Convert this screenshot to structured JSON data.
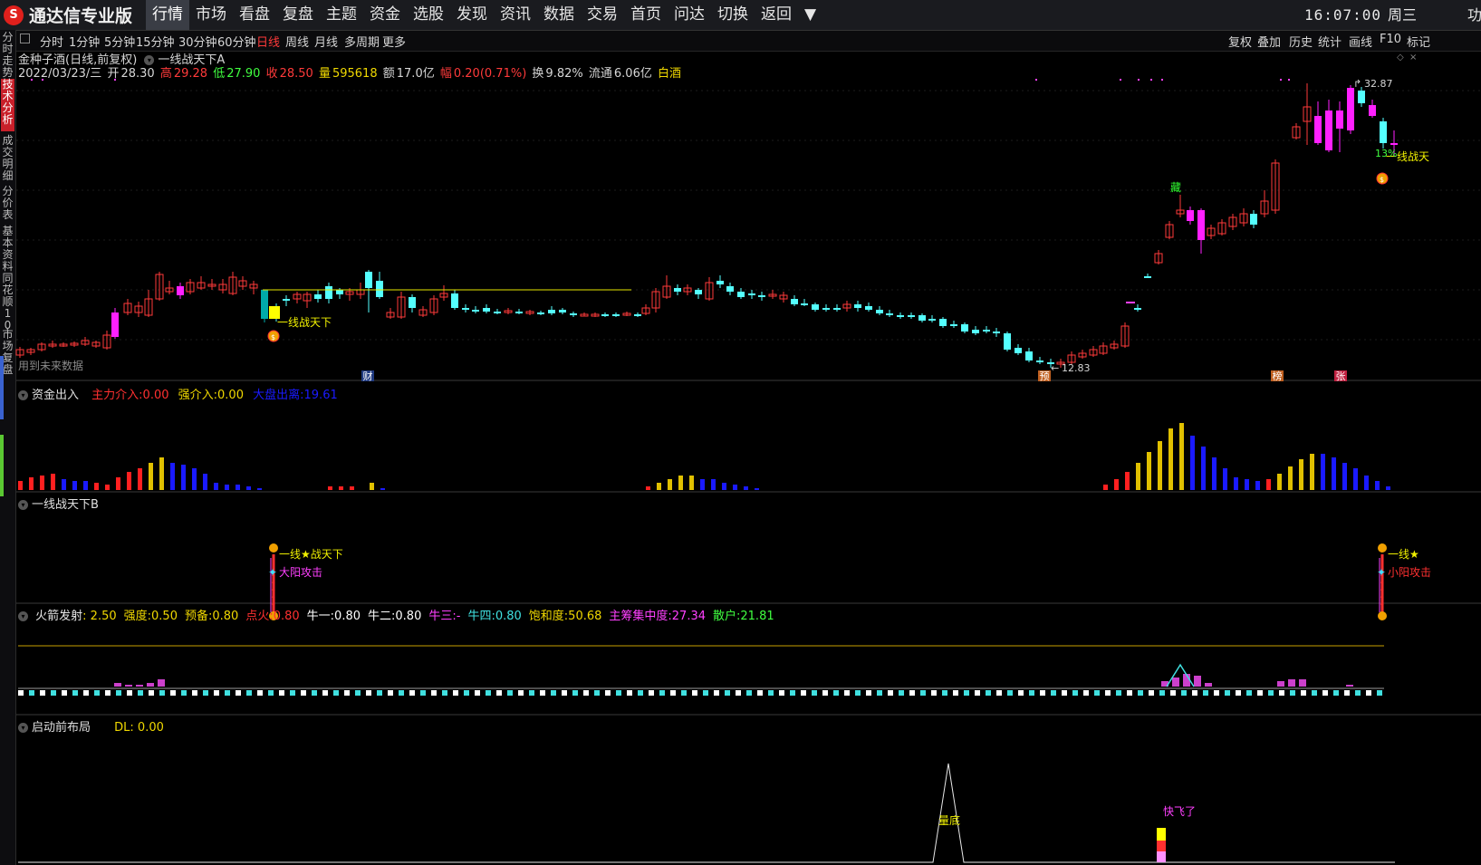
{
  "app": {
    "logo_glyph": "S",
    "title": "通达信专业版"
  },
  "menu": [
    "行情",
    "市场",
    "看盘",
    "复盘",
    "主题",
    "资金",
    "选股",
    "发现",
    "资讯",
    "数据",
    "交易",
    "首页",
    "问达",
    "切换",
    "返回",
    "▼"
  ],
  "clock": {
    "time": "16:07:00",
    "weekday": "周三",
    "right_char": "功"
  },
  "sidebar": [
    "分时走势",
    "技术分析",
    "成交明细",
    "分价表",
    "基本资料",
    "同花顺10",
    "市场复盘"
  ],
  "toolbar": {
    "left": [
      "分时",
      "1分钟",
      "5分钟",
      "15分钟",
      "30分钟",
      "60分钟",
      "日线",
      "周线",
      "月线",
      "多周期",
      "更多"
    ],
    "active": "日线",
    "right": [
      "复权",
      "叠加",
      "历史",
      "统计",
      "画线",
      "F10",
      "标记"
    ]
  },
  "stock": {
    "name_line": "金种子酒(日线,前复权)",
    "indicator": "一线战天下A",
    "date": "2022/03/23/三",
    "open_label": "开",
    "open": "28.30",
    "high_label": "高",
    "high": "29.28",
    "low_label": "低",
    "low": "27.90",
    "close_label": "收",
    "close": "28.50",
    "vol_label": "量",
    "vol": "595618",
    "amt_label": "额",
    "amt": "17.0亿",
    "chg_label": "幅",
    "chg": "0.20(0.71%)",
    "turn_label": "换",
    "turn": "9.82%",
    "float_label": "流通",
    "float": "6.06亿",
    "sector": "白酒"
  },
  "main_chart": {
    "future_note": "用到未来数据",
    "sig_label_left": "一线战天下",
    "sig_label_right": "一线战天",
    "high_mark": "32.87",
    "low_mark": "12.83",
    "pct_label": "13%",
    "tag_cai": "财",
    "tag_yu": "预",
    "tag_bang": "榜",
    "tag_zhang": "张",
    "tag_zang": "藏"
  },
  "panel_funds": {
    "title": "资金出入",
    "l1": "主力介入:",
    "v1": "0.00",
    "l2": "强介入:",
    "v2": "0.00",
    "l3": "大盘出离:",
    "v3": "19.61"
  },
  "panel_b": {
    "title": "一线战天下B",
    "lbl1": "一线★战天下",
    "lbl2": "大阳攻击",
    "lbl3": "一线★",
    "lbl4": "小阳攻击"
  },
  "panel_rocket": {
    "title": "火箭发射",
    "items": [
      {
        "l": "火箭发射",
        "v": ": 2.50",
        "c": "#e8e8e8"
      },
      {
        "l": "强度:",
        "v": "0.50",
        "c": "#f0d800"
      },
      {
        "l": "预备:",
        "v": "0.80",
        "c": "#f0d800"
      },
      {
        "l": "点火:",
        "v": "0.80",
        "c": "#ff3030"
      },
      {
        "l": "牛一:",
        "v": "0.80",
        "c": "#ffffff"
      },
      {
        "l": "牛二:",
        "v": "0.80",
        "c": "#ffffff"
      },
      {
        "l": "牛三:",
        "v": "-",
        "c": "#ff40ff"
      },
      {
        "l": "牛四:",
        "v": "0.80",
        "c": "#40e0e0"
      },
      {
        "l": "饱和度:",
        "v": "50.68",
        "c": "#f0d800"
      },
      {
        "l": "主筹集中度:",
        "v": "27.34",
        "c": "#ff40ff"
      },
      {
        "l": "散户:",
        "v": "21.81",
        "c": "#40ff40"
      }
    ]
  },
  "panel_qidong": {
    "title": "启动前布局",
    "dl": "DL: 0.00",
    "lbl_a": "量底",
    "lbl_b": "快飞了"
  },
  "colors": {
    "up": "#ff3a3a",
    "down": "#54ffff",
    "bull": "#ff20ff",
    "yellow": "#f0d800",
    "blue": "#1a1aff",
    "green": "#40ff40"
  }
}
